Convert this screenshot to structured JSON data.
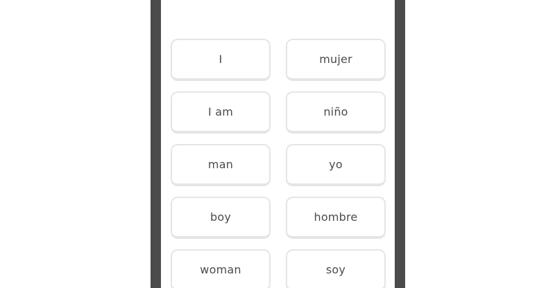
{
  "matching_exercise": {
    "left_column": [
      {
        "label": "I"
      },
      {
        "label": "I am"
      },
      {
        "label": "man"
      },
      {
        "label": "boy"
      },
      {
        "label": "woman"
      }
    ],
    "right_column": [
      {
        "label": "mujer"
      },
      {
        "label": "niño"
      },
      {
        "label": "yo"
      },
      {
        "label": "hombre"
      },
      {
        "label": "soy"
      }
    ]
  },
  "colors": {
    "frame": "#4b4b4b",
    "tile_border": "#e5e5e5",
    "tile_text": "#4b4b4b",
    "background": "#ffffff"
  }
}
